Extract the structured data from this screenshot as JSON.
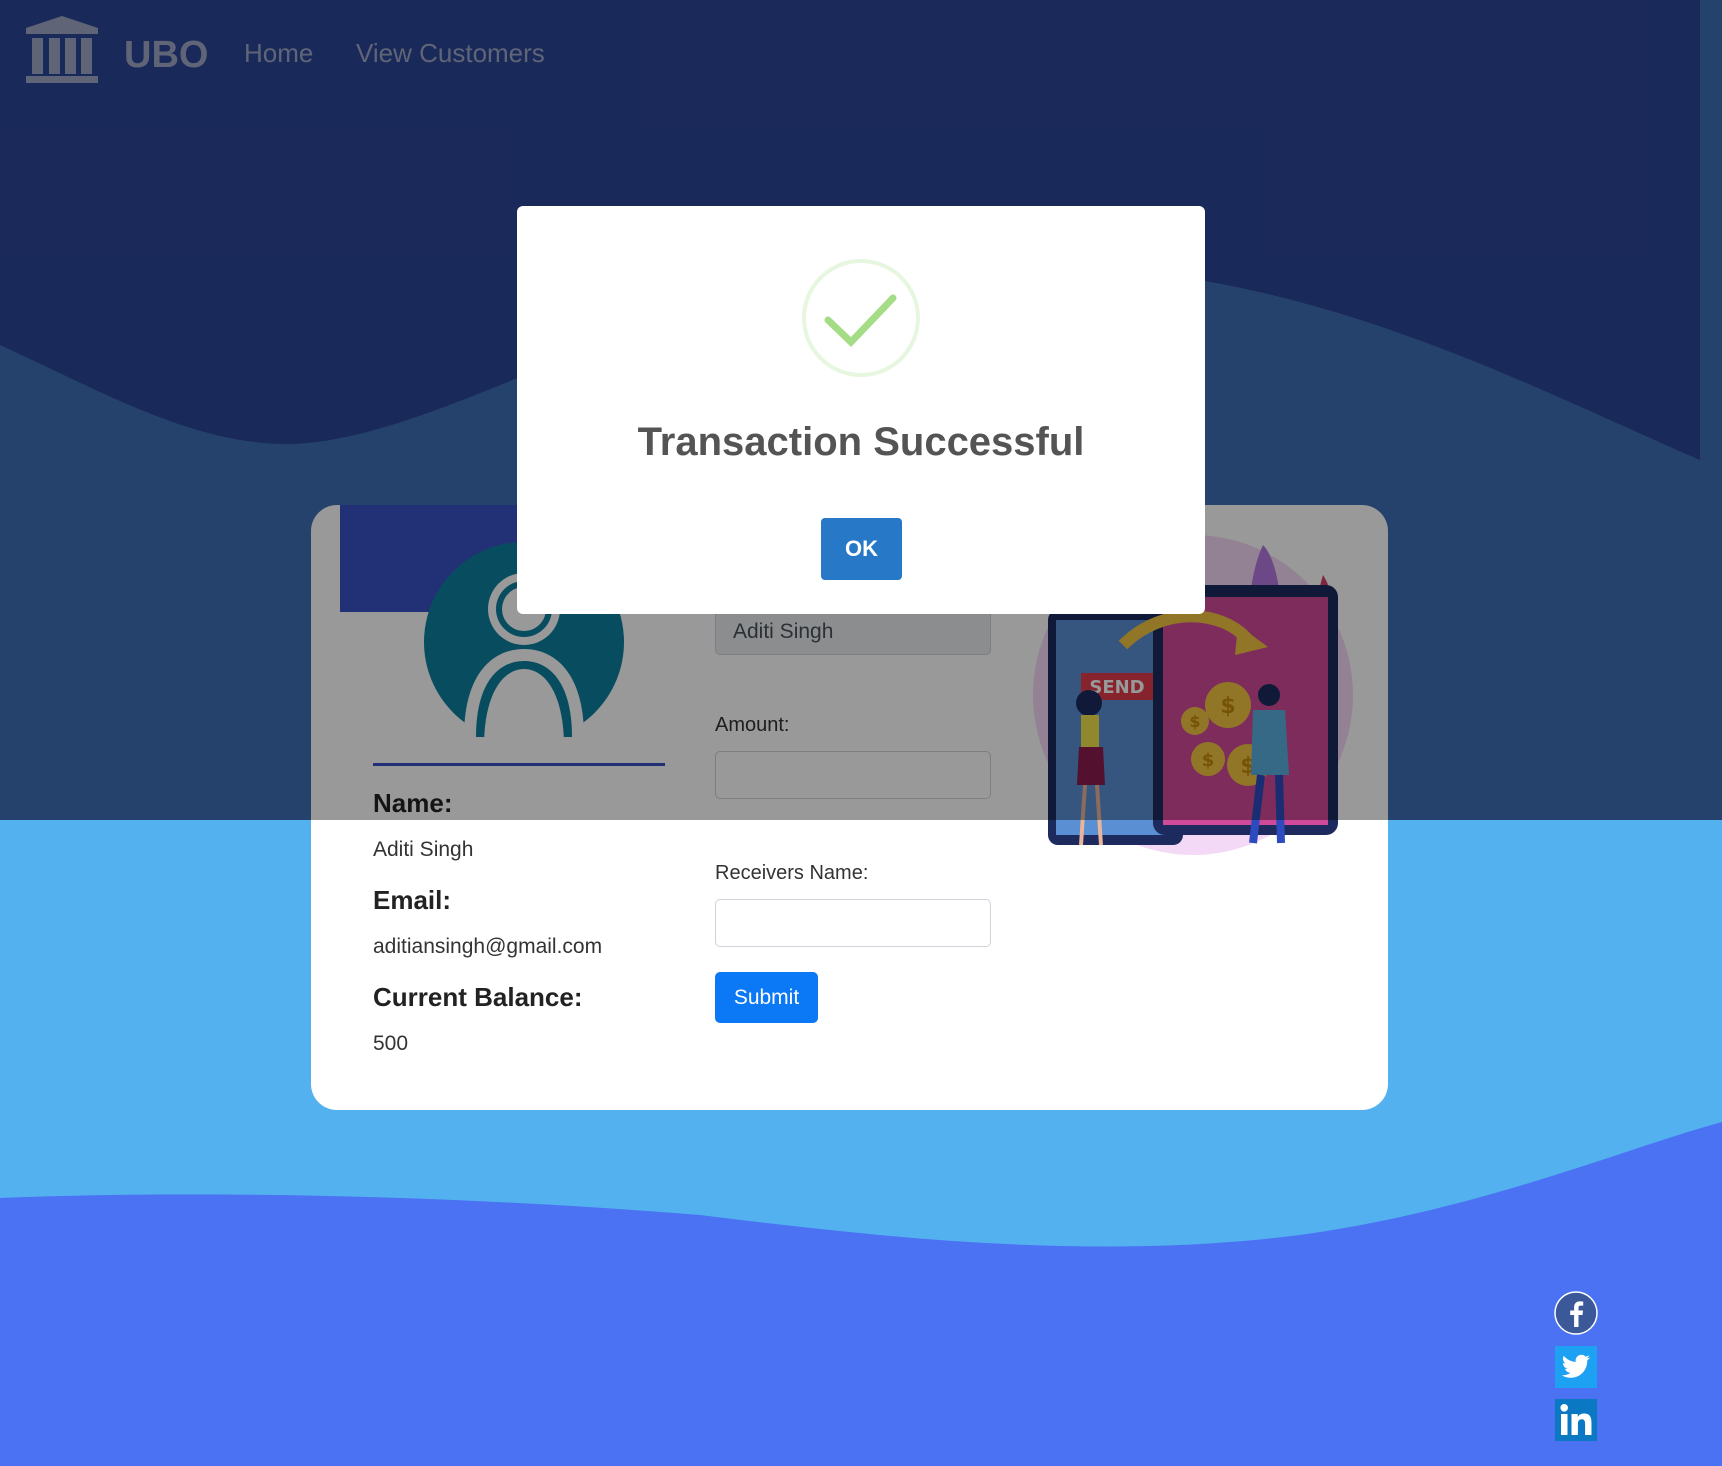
{
  "navbar": {
    "brand": "UBO",
    "links": [
      "Home",
      "View Customers"
    ],
    "logo_icon": "bank-building-icon"
  },
  "profile": {
    "name_label": "Name:",
    "name_value": "Aditi Singh",
    "email_label": "Email:",
    "email_value": "aditiansingh@gmail.com",
    "balance_label": "Current Balance:",
    "balance_value": "500",
    "avatar_icon": "user-avatar-icon"
  },
  "transfer_form": {
    "sender_value": "Aditi Singh",
    "amount_label": "Amount:",
    "amount_value": "",
    "receiver_label": "Receivers Name:",
    "receiver_value": "",
    "submit_label": "Submit"
  },
  "illustration": {
    "send_text": "SEND"
  },
  "modal": {
    "title": "Transaction Successful",
    "ok_label": "OK",
    "icon": "success-check-icon"
  },
  "social": {
    "icons": [
      "facebook-icon",
      "twitter-icon",
      "linkedin-icon"
    ]
  },
  "colors": {
    "nav_bg": "#2b4595",
    "mid_bg": "#53b1f0",
    "bottom_bg": "#4a72f2",
    "submit": "#0b78f5",
    "ok": "#2878c8",
    "success": "#a5dc86"
  }
}
